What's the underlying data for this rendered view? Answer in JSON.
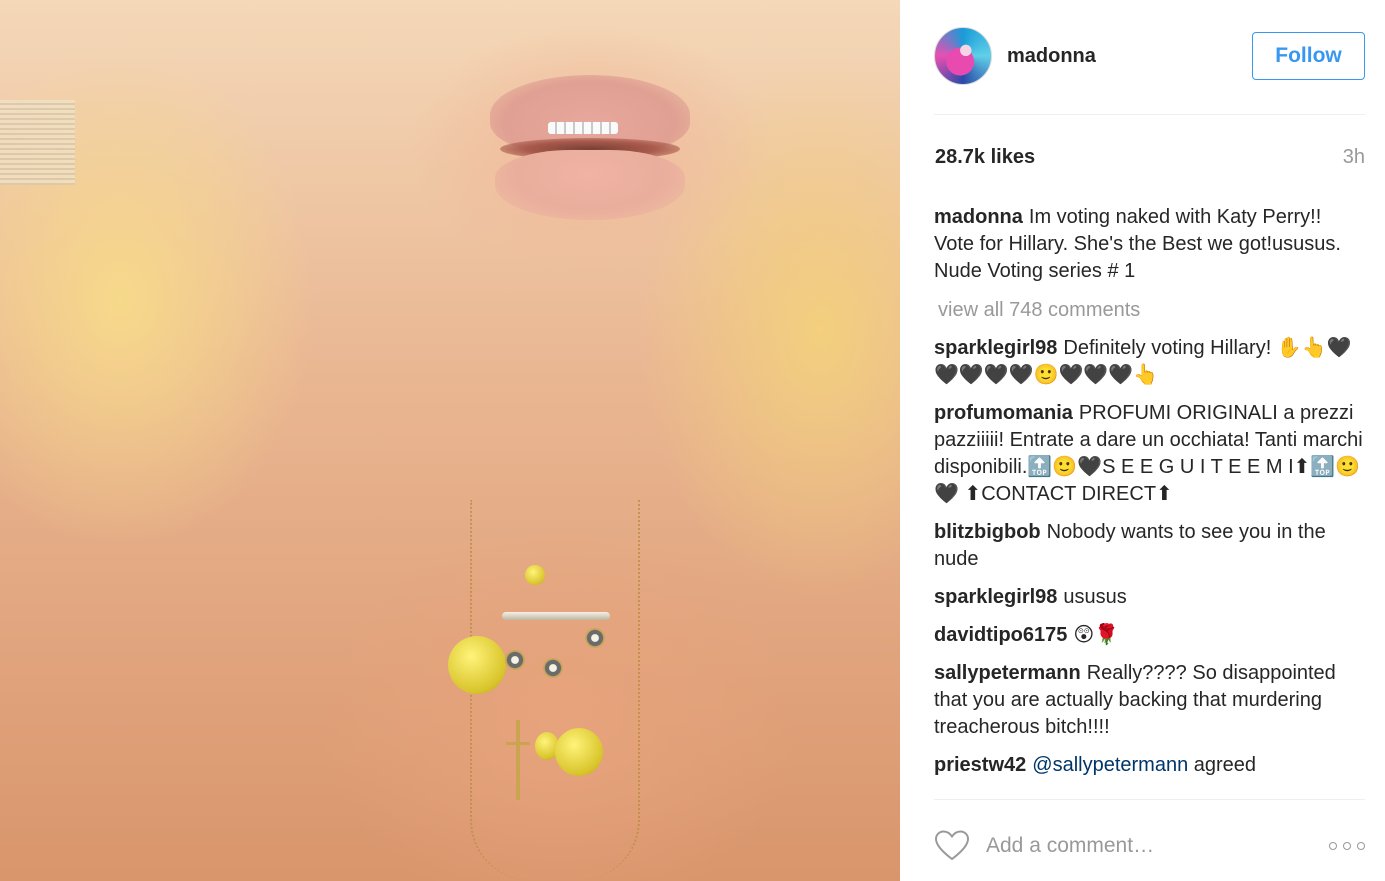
{
  "post": {
    "image_alt": "photo",
    "author": "madonna",
    "follow_label": "Follow",
    "likes": "28.7k likes",
    "time": "3h"
  },
  "caption": {
    "user": "madonna",
    "text": "Im voting naked with Katy Perry!! Vote for Hillary. She's the Best we got!ususus. Nude Voting series # 1"
  },
  "view_all": "view all 748 comments",
  "comments": [
    {
      "user": "sparklegirl98",
      "text": "Definitely voting Hillary! ✋👆🖤🖤🖤🖤🖤🙂🖤🖤🖤👆"
    },
    {
      "user": "profumomania",
      "text": "PROFUMI ORIGINALI a prezzi pazziiiii! Entrate a dare un occhiata! Tanti marchi disponibili.🔝🙂🖤S E E G U I T E E M I⬆🔝🙂🖤 ⬆CONTACT DIRECT⬆"
    },
    {
      "user": "blitzbigbob",
      "text": "Nobody wants to see you in the nude"
    },
    {
      "user": "sparklegirl98",
      "text": "ususus"
    },
    {
      "user": "davidtipo6175",
      "text": "😲🌹"
    },
    {
      "user": "sallypetermann",
      "text": "Really???? So disappointed that you are actually backing that murdering treacherous bitch!!!!"
    },
    {
      "user": "priestw42",
      "mention": "@sallypetermann",
      "text": "agreed"
    }
  ],
  "footer": {
    "comment_placeholder": "Add a comment…"
  },
  "icons": {
    "like": "heart-icon",
    "more": "more-options-icon"
  },
  "colors": {
    "accent": "#3897f0",
    "muted": "#999999",
    "text": "#262626"
  }
}
